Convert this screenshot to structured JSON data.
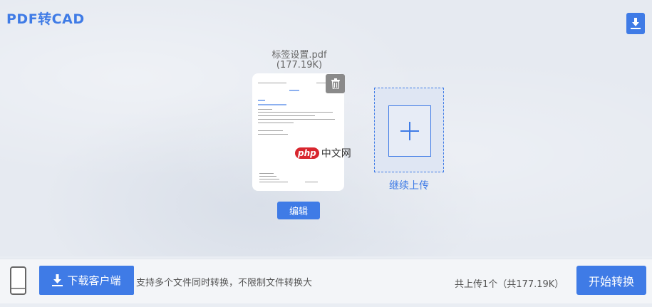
{
  "app": {
    "title": "PDF转CAD"
  },
  "file": {
    "name": "标签设置.pdf",
    "size": "(177.19K)",
    "edit_label": "编辑",
    "watermark_badge": "php",
    "watermark_text": "中文网"
  },
  "upload": {
    "continue_label": "继续上传"
  },
  "footer": {
    "download_client_label": "下载客户端",
    "hint": "支持多个文件同时转换，不限制文件转换大",
    "count": "共上传1个（共177.19K）",
    "start_label": "开始转换"
  },
  "colors": {
    "accent": "#3f7be6",
    "trash": "#8a8a8a",
    "background": "#e6eaf1"
  },
  "icons": {
    "corner": "download-icon",
    "trash": "trash-icon",
    "upload": "plus-icon",
    "phone": "phone-icon",
    "client": "download-icon"
  }
}
